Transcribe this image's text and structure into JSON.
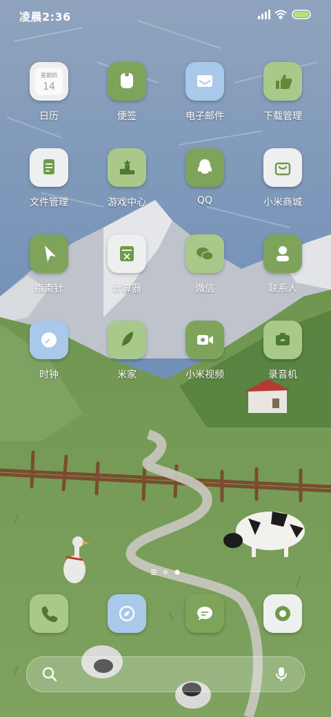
{
  "status_bar": {
    "time": "凌晨2:36"
  },
  "apps": [
    {
      "label": "日历",
      "icon": "calendar-icon",
      "calendar_weekday": "星期四",
      "calendar_day": "14"
    },
    {
      "label": "便签",
      "icon": "notes-icon"
    },
    {
      "label": "电子邮件",
      "icon": "email-icon"
    },
    {
      "label": "下载管理",
      "icon": "thumbs-up-icon"
    },
    {
      "label": "文件管理",
      "icon": "file-icon"
    },
    {
      "label": "游戏中心",
      "icon": "podium-icon"
    },
    {
      "label": "QQ",
      "icon": "qq-penguin-icon"
    },
    {
      "label": "小米商城",
      "icon": "shopping-bag-icon"
    },
    {
      "label": "指南针",
      "icon": "compass-pointer-icon"
    },
    {
      "label": "计算器",
      "icon": "calculator-icon"
    },
    {
      "label": "微信",
      "icon": "wechat-icon"
    },
    {
      "label": "联系人",
      "icon": "contact-icon"
    },
    {
      "label": "时钟",
      "icon": "clock-icon"
    },
    {
      "label": "米家",
      "icon": "leaf-icon"
    },
    {
      "label": "小米视频",
      "icon": "video-camera-icon"
    },
    {
      "label": "录音机",
      "icon": "recorder-icon"
    }
  ],
  "dock": [
    {
      "icon": "phone-icon"
    },
    {
      "icon": "browser-compass-icon"
    },
    {
      "icon": "message-bubble-icon"
    },
    {
      "icon": "camera-icon"
    }
  ],
  "page_indicator": {
    "pages": 2,
    "current": 2
  },
  "colors": {
    "green_tile": "#7ea35a",
    "light_green_tile": "#a9c98a",
    "white_tile": "#eef0ef",
    "blue_tile": "#a9c9ea"
  }
}
